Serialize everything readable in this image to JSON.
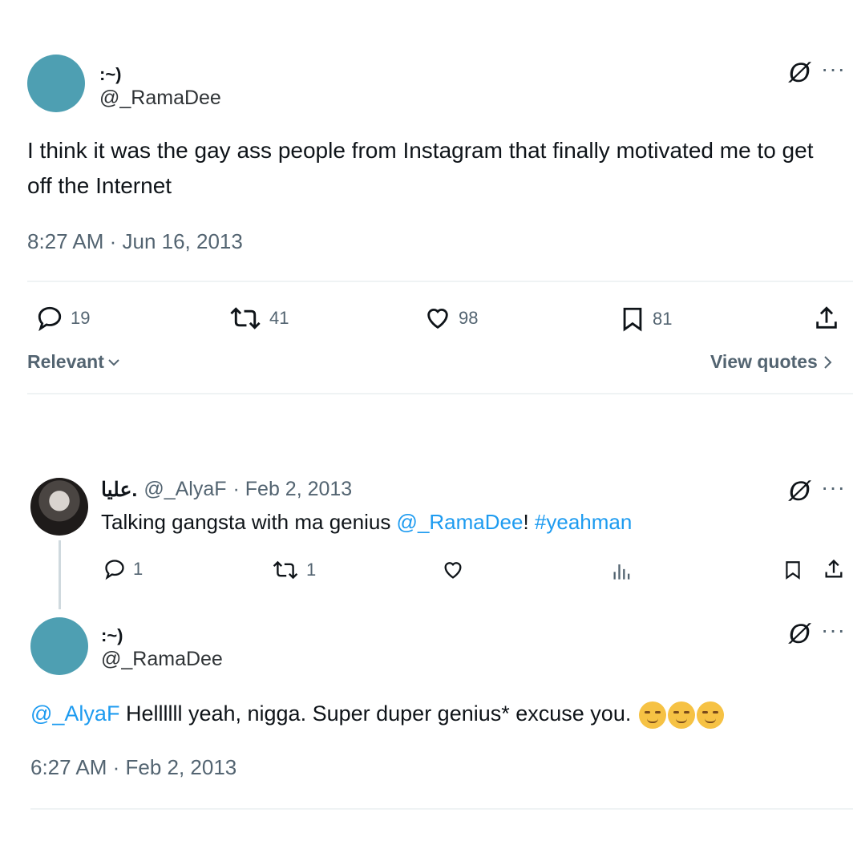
{
  "main_tweet": {
    "display_name": ":~)",
    "handle": "@_RamaDee",
    "text": "I think it was the gay ass people from Instagram that finally motivated me to get off the Internet",
    "timestamp": "8:27 AM · Jun 16, 2013",
    "stats": {
      "replies": "19",
      "retweets": "41",
      "likes": "98",
      "bookmarks": "81"
    },
    "sort_label": "Relevant",
    "view_quotes_label": "View quotes"
  },
  "reply_parent": {
    "display_name": "عليا.",
    "handle": "@_AlyaF",
    "date": "· Feb 2, 2013",
    "text_prefix": "Talking gangsta with ma genius ",
    "mention": "@_RamaDee",
    "text_mid": "! ",
    "hashtag": "#yeahman",
    "stats": {
      "replies": "1",
      "retweets": "1"
    }
  },
  "reply_child": {
    "display_name": ":~)",
    "handle": "@_RamaDee",
    "mention": "@_AlyaF",
    "text": " Hellllll yeah, nigga. Super duper genius* excuse you. ",
    "emojis": [
      "smirk-emoji",
      "smirk-emoji",
      "smirk-emoji"
    ],
    "timestamp": "6:27 AM · Feb 2, 2013"
  },
  "icons": {
    "more": "···",
    "grok": "Ø"
  },
  "colors": {
    "link": "#1d9bf0",
    "avatar": "#4e9fb2",
    "muted": "#536471"
  }
}
